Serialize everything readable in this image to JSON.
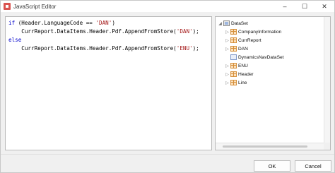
{
  "window": {
    "title": "JavaScript Editor",
    "controls": {
      "minimize": "–",
      "maximize": "☐",
      "close": "✕"
    }
  },
  "editor": {
    "lines": [
      {
        "pre": "if (Header.LanguageCode == ",
        "str": "'DAN'",
        "post": ")"
      },
      {
        "pre": "    CurrReport.DataItems.Header.Pdf.AppendFromStore(",
        "str": "'DAN'",
        "post": ");"
      },
      {
        "pre": "else",
        "str": "",
        "post": ""
      },
      {
        "pre": "    CurrReport.DataItems.Header.Pdf.AppendFromStore(",
        "str": "'ENU'",
        "post": ");"
      }
    ]
  },
  "tree": {
    "root": {
      "label": "DataSet",
      "expander": "◢"
    },
    "items": [
      {
        "label": "CompanyInformation",
        "expander": "▷"
      },
      {
        "label": "CurrReport",
        "expander": "▷"
      },
      {
        "label": "DAN",
        "expander": "▷"
      },
      {
        "label": "DynamicsNavDataSet",
        "expander": ""
      },
      {
        "label": "ENU",
        "expander": "▷"
      },
      {
        "label": "Header",
        "expander": "▷"
      },
      {
        "label": "Line",
        "expander": "▷"
      }
    ]
  },
  "buttons": {
    "ok": "OK",
    "cancel": "Cancel"
  },
  "colors": {
    "keyword": "#0000cc",
    "string": "#a31515"
  }
}
